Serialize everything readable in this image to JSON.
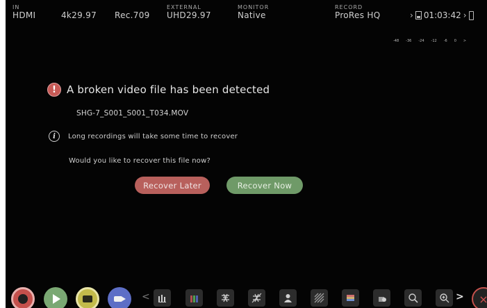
{
  "header": {
    "input": {
      "caption": "IN",
      "value": "HDMI"
    },
    "format": {
      "value": "4k29.97"
    },
    "color_space": {
      "value": "Rec.709"
    },
    "external": {
      "caption": "EXTERNAL",
      "value": "UHD29.97"
    },
    "monitor": {
      "caption": "MONITOR",
      "value": "Native"
    },
    "record": {
      "caption": "RECORD",
      "value": "ProRes HQ"
    },
    "timecode": "01:03:42"
  },
  "audio_meter_scale": [
    "-48",
    "-36",
    "-24",
    "-12",
    "-6",
    "0",
    ">"
  ],
  "dialog": {
    "title": "A broken video file has been detected",
    "warning_glyph": "!",
    "filename": "SHG-7_S001_S001_T034.MOV",
    "info_glyph": "i",
    "info_text": "Long recordings will take some time to recover",
    "question": "Would you like to recover this file now?",
    "recover_later_label": "Recover Later",
    "recover_now_label": "Recover Now"
  },
  "bottom_bar": {
    "buttons": [
      {
        "icon": "record-icon",
        "color": "#c4504c"
      },
      {
        "icon": "play-icon",
        "color": "#7aa873"
      },
      {
        "icon": "monitor-icon",
        "color": "#c3bb4b"
      },
      {
        "icon": "camera-icon",
        "color": "#5d6ec6"
      }
    ],
    "tools": [
      "waveform-icon",
      "rgb-parade-icon",
      "focus-peaking-icon",
      "focus-peaking-off-icon",
      "false-color-icon",
      "zebra-icon",
      "frame-guides-icon",
      "lut-icon",
      "zoom-icon",
      "zoom-plus-icon"
    ],
    "prev_glyph": "<",
    "next_glyph": ">",
    "close_glyph": "×"
  },
  "colors": {
    "background": "#040404",
    "recover_later": "#b8605c",
    "recover_now": "#6f9a68",
    "warning": "#c75a56"
  }
}
